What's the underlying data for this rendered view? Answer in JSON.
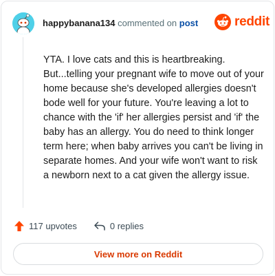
{
  "comment": {
    "username": "happybanana134",
    "action_text": "commented on",
    "post_link_text": "post",
    "body": "YTA. I love cats and this is heartbreaking. But...telling your pregnant wife to move out of your home because she's developed allergies doesn't bode well for your future. You're leaving a lot to chance with the 'if' her allergies persist and 'if' the baby has an allergy. You do need to think longer term here; when baby arrives you can't be living in separate homes. And your wife won't want to risk a newborn next to a cat given the allergy issue."
  },
  "brand": {
    "name": "reddit",
    "logo_icon": "reddit-snoo-icon",
    "color": "#ff4500"
  },
  "actions": {
    "upvotes_label": "117 upvotes",
    "upvote_icon": "upvote-arrow-icon",
    "replies_label": "0 replies",
    "reply_icon": "reply-arrow-icon"
  },
  "footer": {
    "view_more_label": "View more on Reddit"
  },
  "colors": {
    "avatar_bg": "#4fd0e8",
    "upvote": "#ff4500",
    "link": "#0a4fa6",
    "button_text": "#d93900"
  }
}
